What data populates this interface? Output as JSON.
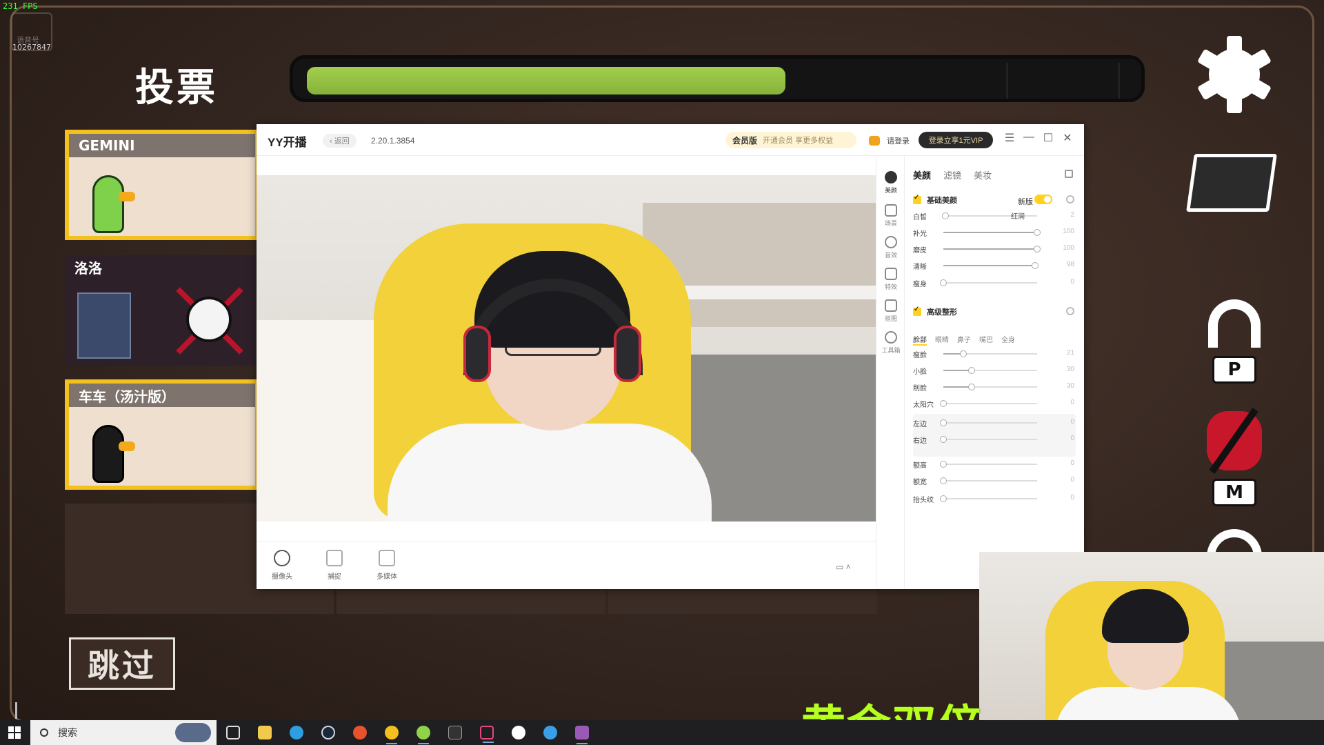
{
  "overlay": {
    "fps": "231 FPS",
    "room_badge": "语音号",
    "room_id": "10267847"
  },
  "game": {
    "vote_title": "投票",
    "timer_progress": 0.58,
    "skip_label": "跳过",
    "players": [
      {
        "name": "GEMINI",
        "status": "alive"
      },
      {
        "name": "洛洛",
        "status": "dead"
      },
      {
        "name": "车车（汤汁版）",
        "status": "alive"
      }
    ],
    "side_buttons": {
      "settings_icon": "gear-icon",
      "map_icon": "map-icon",
      "voice_key": "P",
      "mic_key": "M"
    }
  },
  "yy": {
    "app_title": "YY开播",
    "back_label": "‹ 返回",
    "version": "2.20.1.3854",
    "member_label": "会员版",
    "member_sub": "开通会员 享更多权益",
    "login_label": "请登录",
    "vip_label": "登录立享1元VIP",
    "bottom_tools": [
      {
        "label": "摄像头"
      },
      {
        "label": "捕捉"
      },
      {
        "label": "多媒体"
      }
    ],
    "nav": [
      {
        "label": "美颜"
      },
      {
        "label": "场景"
      },
      {
        "label": "音效"
      },
      {
        "label": "特效"
      },
      {
        "label": "抠图"
      },
      {
        "label": "工具箱"
      }
    ],
    "panel": {
      "tabs": [
        "美颜",
        "滤镜",
        "美妆"
      ],
      "basic_title": "基础美颜",
      "new_label": "新版",
      "basic_sliders": [
        {
          "name": "白皙",
          "value": 2,
          "extra": "红润"
        },
        {
          "name": "补光",
          "value": 100
        },
        {
          "name": "磨皮",
          "value": 100
        },
        {
          "name": "清晰",
          "value": 98
        },
        {
          "name": "瘦身",
          "value": 0
        }
      ],
      "adv_title": "高级整形",
      "sub_tabs": [
        "脸部",
        "眼睛",
        "鼻子",
        "嘴巴",
        "全身"
      ],
      "adv_sliders": [
        {
          "name": "瘦脸",
          "value": 21
        },
        {
          "name": "小脸",
          "value": 30
        },
        {
          "name": "削脸",
          "value": 30
        },
        {
          "name": "太阳穴",
          "value": 0
        },
        {
          "name": "左边",
          "value": 0
        },
        {
          "name": "右边",
          "value": 0
        },
        {
          "name": "额高",
          "value": 0
        },
        {
          "name": "额宽",
          "value": 0
        },
        {
          "name": "抬头纹",
          "value": 0
        }
      ]
    }
  },
  "stream": {
    "caption": "黄金双倍"
  },
  "taskbar": {
    "search_placeholder": "搜索"
  }
}
